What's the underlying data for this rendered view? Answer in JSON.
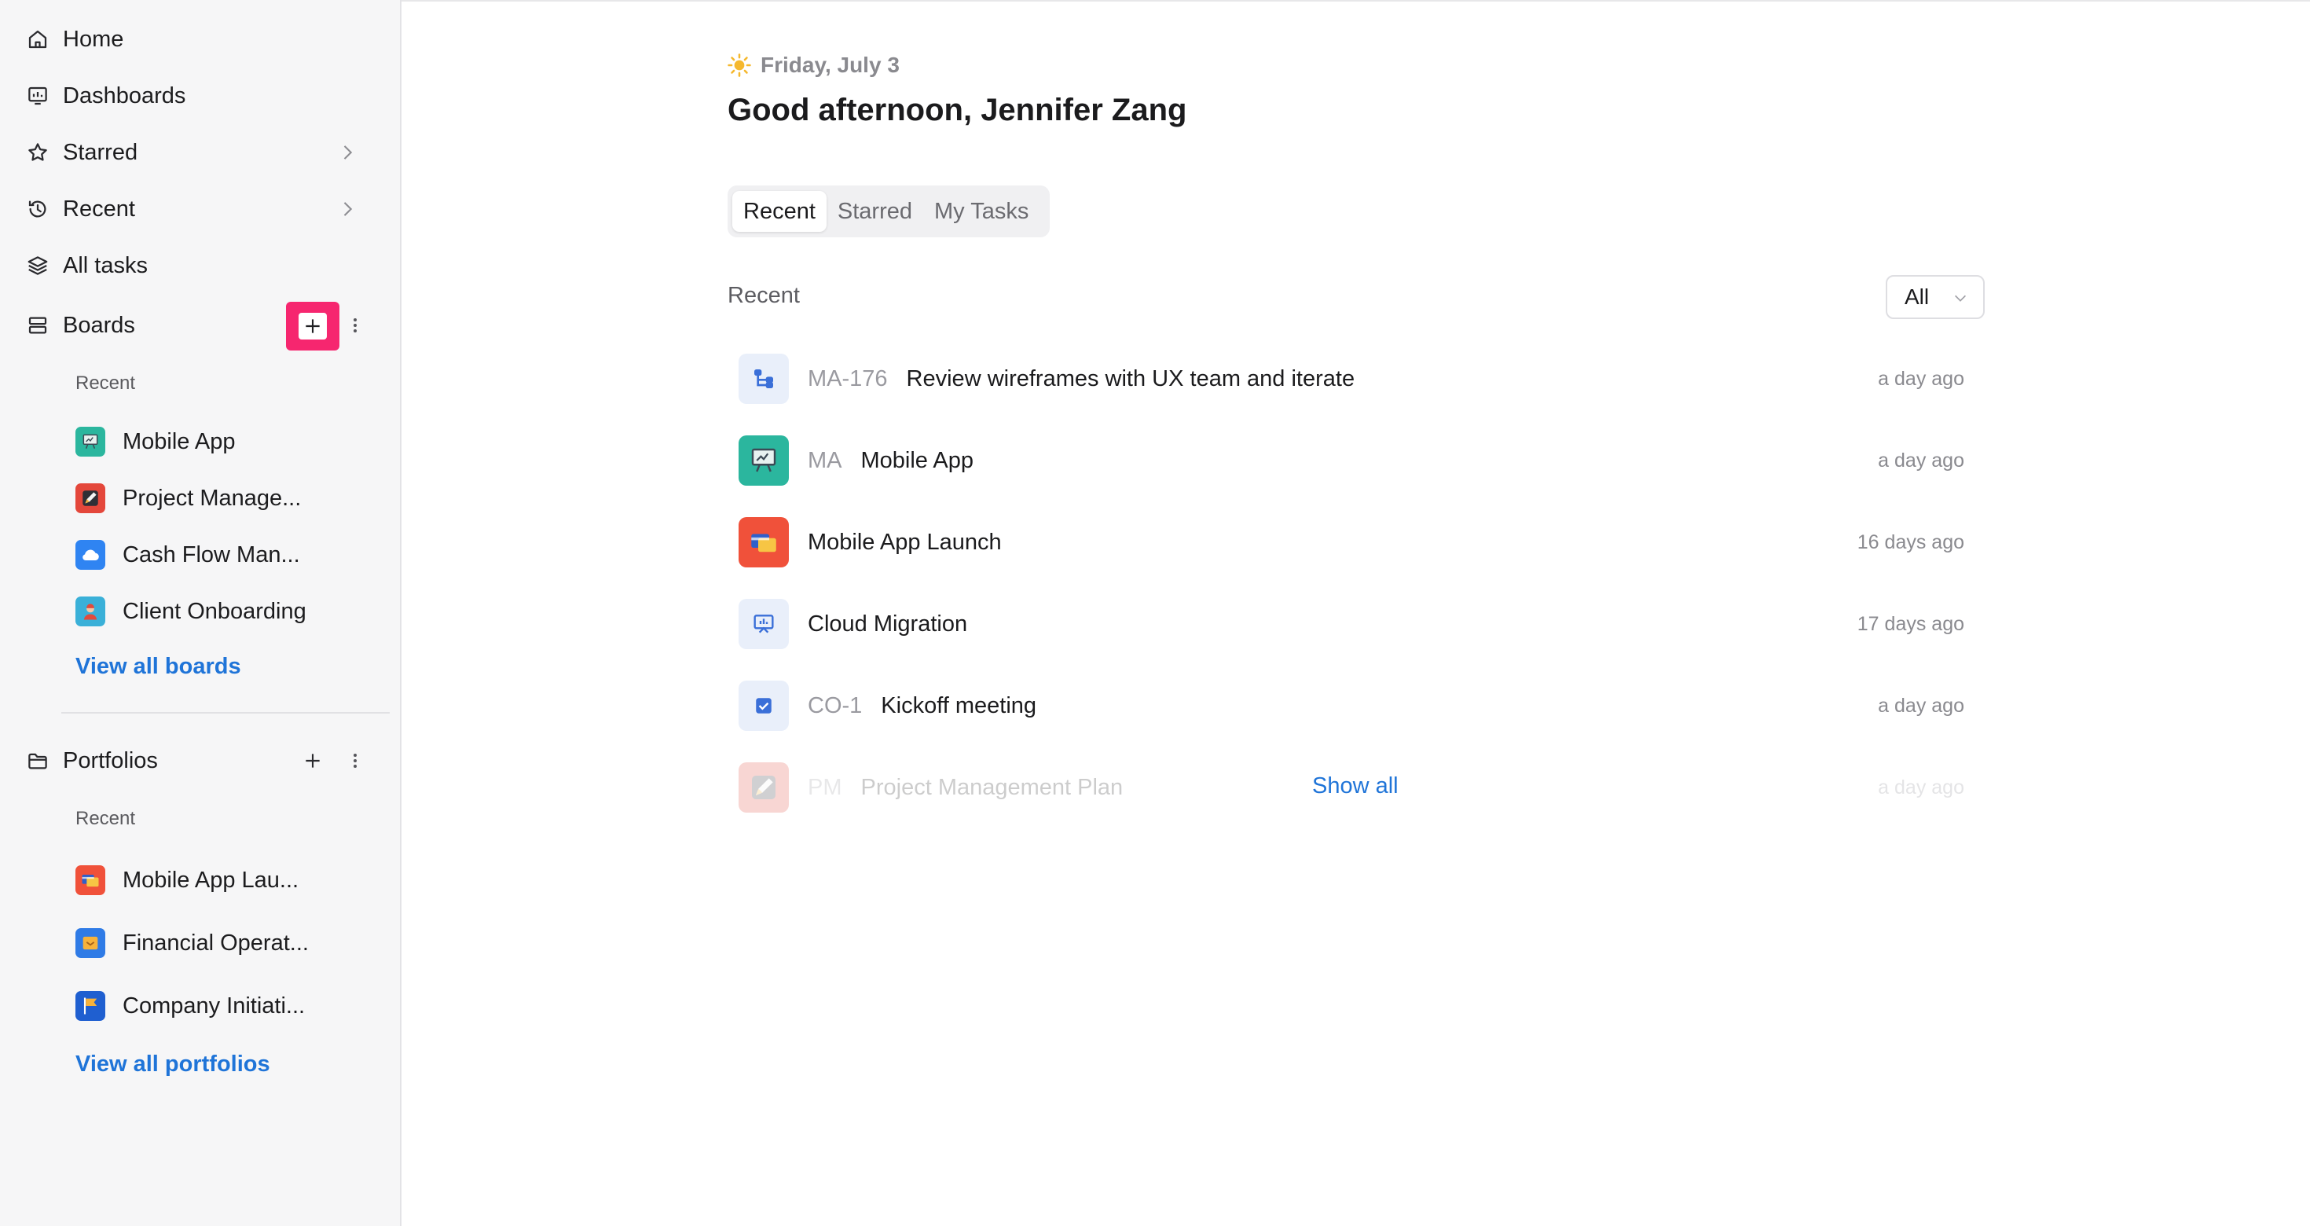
{
  "sidebar": {
    "nav": [
      {
        "label": "Home",
        "icon": "home-icon"
      },
      {
        "label": "Dashboards",
        "icon": "dashboard-icon"
      },
      {
        "label": "Starred",
        "icon": "star-icon"
      },
      {
        "label": "Recent",
        "icon": "history-icon"
      },
      {
        "label": "All tasks",
        "icon": "layers-icon"
      }
    ],
    "boards": {
      "label": "Boards",
      "recent_label": "Recent",
      "items": [
        {
          "label": "Mobile App",
          "icon": "easel-icon",
          "color": "#2bb69e"
        },
        {
          "label": "Project Manage...",
          "icon": "pen-icon",
          "color": "#e4473b"
        },
        {
          "label": "Cash Flow Man...",
          "icon": "cloud-icon",
          "color": "#2f84f2"
        },
        {
          "label": "Client Onboarding",
          "icon": "person-icon",
          "color": "#3ab0d8"
        }
      ],
      "view_all": "View all boards"
    },
    "portfolios": {
      "label": "Portfolios",
      "recent_label": "Recent",
      "items": [
        {
          "label": "Mobile App Lau...",
          "icon": "cards-icon",
          "color": "#f0513a"
        },
        {
          "label": "Financial Operat...",
          "icon": "money-icon",
          "color": "#2f7be6"
        },
        {
          "label": "Company Initiati...",
          "icon": "flag-icon",
          "color": "#1f5fd0"
        }
      ],
      "view_all": "View all portfolios"
    }
  },
  "main": {
    "date": "Friday, July 3",
    "greeting": "Good afternoon, Jennifer Zang",
    "tabs": [
      {
        "label": "Recent",
        "active": true
      },
      {
        "label": "Starred",
        "active": false
      },
      {
        "label": "My Tasks",
        "active": false
      }
    ],
    "recent_heading": "Recent",
    "filter": {
      "label": "All"
    },
    "items": [
      {
        "key": "MA-176",
        "title": "Review wireframes with UX team and iterate",
        "time": "a day ago",
        "icon": "subtask-icon"
      },
      {
        "key": "MA",
        "title": "Mobile App",
        "time": "a day ago",
        "icon": "easel-icon"
      },
      {
        "key": "",
        "title": "Mobile App Launch",
        "time": "16 days ago",
        "icon": "cards-icon"
      },
      {
        "key": "",
        "title": "Cloud Migration",
        "time": "17 days ago",
        "icon": "presentation-icon"
      },
      {
        "key": "CO-1",
        "title": "Kickoff meeting",
        "time": "a day ago",
        "icon": "checkbox-icon"
      },
      {
        "key": "PM",
        "title": "Project Management Plan",
        "time": "a day ago",
        "icon": "pen-icon"
      }
    ],
    "show_all": "Show all"
  }
}
